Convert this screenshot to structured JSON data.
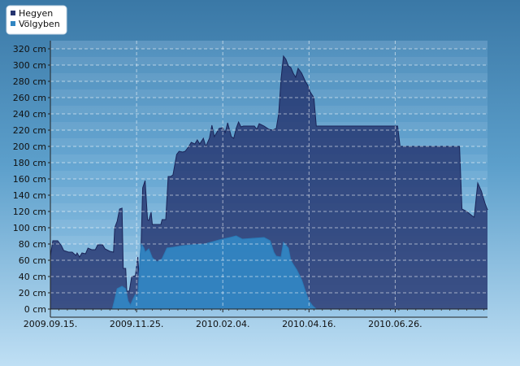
{
  "chart_data": {
    "type": "area",
    "y_unit": "cm",
    "ylim": [
      0,
      330
    ],
    "y_ticks": [
      "0 cm",
      "20 cm",
      "40 cm",
      "60 cm",
      "80 cm",
      "100 cm",
      "120 cm",
      "140 cm",
      "160 cm",
      "180 cm",
      "200 cm",
      "220 cm",
      "240 cm",
      "260 cm",
      "280 cm",
      "300 cm",
      "320 cm"
    ],
    "y_tick_values": [
      0,
      20,
      40,
      60,
      80,
      100,
      120,
      140,
      160,
      180,
      200,
      220,
      240,
      260,
      280,
      300,
      320
    ],
    "x_range": [
      "2009-09-15",
      "2010-09-10"
    ],
    "x_ticks": [
      {
        "date": "2009-09-15",
        "label": "2009.09.15."
      },
      {
        "date": "2009-11-25",
        "label": "2009.11.25."
      },
      {
        "date": "2010-02-04",
        "label": "2010.02.04."
      },
      {
        "date": "2010-04-16",
        "label": "2010.04.16."
      },
      {
        "date": "2010-06-26",
        "label": "2010.06.26."
      }
    ],
    "grid": true,
    "legend_position": "top-left",
    "series": [
      {
        "name": "Hegyen",
        "color": "#25346f",
        "points": [
          [
            "2009-09-15",
            65
          ],
          [
            "2009-09-17",
            84
          ],
          [
            "2009-09-21",
            84
          ],
          [
            "2009-09-24",
            78
          ],
          [
            "2009-09-26",
            72
          ],
          [
            "2009-09-30",
            70
          ],
          [
            "2009-10-03",
            70
          ],
          [
            "2009-10-06",
            66
          ],
          [
            "2009-10-07",
            69
          ],
          [
            "2009-10-09",
            64
          ],
          [
            "2009-10-11",
            69
          ],
          [
            "2009-10-14",
            68
          ],
          [
            "2009-10-16",
            75
          ],
          [
            "2009-10-19",
            73
          ],
          [
            "2009-10-22",
            73
          ],
          [
            "2009-10-24",
            79
          ],
          [
            "2009-10-28",
            79
          ],
          [
            "2009-10-30",
            74
          ],
          [
            "2009-11-03",
            71
          ],
          [
            "2009-11-06",
            70
          ],
          [
            "2009-11-07",
            100
          ],
          [
            "2009-11-09",
            108
          ],
          [
            "2009-11-11",
            123
          ],
          [
            "2009-11-13",
            124
          ],
          [
            "2009-11-14",
            50
          ],
          [
            "2009-11-16",
            50
          ],
          [
            "2009-11-17",
            22
          ],
          [
            "2009-11-19",
            22
          ],
          [
            "2009-11-21",
            40
          ],
          [
            "2009-11-24",
            41
          ],
          [
            "2009-11-26",
            64
          ],
          [
            "2009-11-27",
            43
          ],
          [
            "2009-11-28",
            41
          ],
          [
            "2009-11-30",
            149
          ],
          [
            "2009-12-02",
            158
          ],
          [
            "2009-12-04",
            110
          ],
          [
            "2009-12-05",
            109
          ],
          [
            "2009-12-07",
            119
          ],
          [
            "2009-12-08",
            104
          ],
          [
            "2009-12-12",
            104
          ],
          [
            "2009-12-15",
            104
          ],
          [
            "2009-12-16",
            110
          ],
          [
            "2009-12-19",
            110
          ],
          [
            "2009-12-21",
            163
          ],
          [
            "2009-12-23",
            163
          ],
          [
            "2009-12-25",
            165
          ],
          [
            "2009-12-28",
            190
          ],
          [
            "2009-12-30",
            194
          ],
          [
            "2010-01-02",
            193
          ],
          [
            "2010-01-04",
            194
          ],
          [
            "2010-01-07",
            200
          ],
          [
            "2010-01-09",
            205
          ],
          [
            "2010-01-12",
            203
          ],
          [
            "2010-01-14",
            208
          ],
          [
            "2010-01-16",
            203
          ],
          [
            "2010-01-19",
            210
          ],
          [
            "2010-01-21",
            200
          ],
          [
            "2010-01-24",
            210
          ],
          [
            "2010-01-26",
            226
          ],
          [
            "2010-01-28",
            212
          ],
          [
            "2010-02-01",
            222
          ],
          [
            "2010-02-04",
            223
          ],
          [
            "2010-02-06",
            217
          ],
          [
            "2010-02-08",
            229
          ],
          [
            "2010-02-11",
            212
          ],
          [
            "2010-02-13",
            210
          ],
          [
            "2010-02-15",
            222
          ],
          [
            "2010-02-17",
            230
          ],
          [
            "2010-02-19",
            224
          ],
          [
            "2010-02-21",
            225
          ],
          [
            "2010-02-25",
            225
          ],
          [
            "2010-03-02",
            225
          ],
          [
            "2010-03-04",
            221
          ],
          [
            "2010-03-06",
            228
          ],
          [
            "2010-03-10",
            225
          ],
          [
            "2010-03-14",
            221
          ],
          [
            "2010-03-17",
            220
          ],
          [
            "2010-03-20",
            222
          ],
          [
            "2010-03-22",
            240
          ],
          [
            "2010-03-24",
            283
          ],
          [
            "2010-03-26",
            311
          ],
          [
            "2010-03-28",
            307
          ],
          [
            "2010-03-30",
            299
          ],
          [
            "2010-04-01",
            297
          ],
          [
            "2010-04-03",
            290
          ],
          [
            "2010-04-05",
            285
          ],
          [
            "2010-04-07",
            296
          ],
          [
            "2010-04-10",
            290
          ],
          [
            "2010-04-13",
            280
          ],
          [
            "2010-04-15",
            275
          ],
          [
            "2010-04-17",
            267
          ],
          [
            "2010-04-20",
            260
          ],
          [
            "2010-04-22",
            225
          ],
          [
            "2010-05-01",
            225
          ],
          [
            "2010-05-15",
            225
          ],
          [
            "2010-06-01",
            225
          ],
          [
            "2010-06-15",
            225
          ],
          [
            "2010-06-28",
            225
          ],
          [
            "2010-06-30",
            200
          ],
          [
            "2010-07-15",
            200
          ],
          [
            "2010-08-01",
            200
          ],
          [
            "2010-08-18",
            200
          ],
          [
            "2010-08-20",
            123
          ],
          [
            "2010-08-24",
            120
          ],
          [
            "2010-08-28",
            115
          ],
          [
            "2010-08-30",
            113
          ],
          [
            "2010-09-02",
            155
          ],
          [
            "2010-09-05",
            145
          ],
          [
            "2010-09-08",
            130
          ],
          [
            "2010-09-10",
            122
          ],
          [
            "2010-09-12",
            123
          ]
        ]
      },
      {
        "name": "Völgyben",
        "color": "#3185c2",
        "points": [
          [
            "2009-11-05",
            0
          ],
          [
            "2009-11-07",
            12
          ],
          [
            "2009-11-09",
            25
          ],
          [
            "2009-11-13",
            28
          ],
          [
            "2009-11-16",
            25
          ],
          [
            "2009-11-18",
            10
          ],
          [
            "2009-11-20",
            5
          ],
          [
            "2009-11-22",
            12
          ],
          [
            "2009-11-24",
            18
          ],
          [
            "2009-11-26",
            15
          ],
          [
            "2009-11-28",
            68
          ],
          [
            "2009-11-29",
            80
          ],
          [
            "2009-12-01",
            75
          ],
          [
            "2009-12-02",
            70
          ],
          [
            "2009-12-05",
            74
          ],
          [
            "2009-12-08",
            63
          ],
          [
            "2009-12-12",
            58
          ],
          [
            "2009-12-16",
            62
          ],
          [
            "2009-12-20",
            75
          ],
          [
            "2009-12-25",
            76
          ],
          [
            "2010-01-02",
            78
          ],
          [
            "2010-01-10",
            79
          ],
          [
            "2010-01-20",
            80
          ],
          [
            "2010-02-01",
            85
          ],
          [
            "2010-02-10",
            88
          ],
          [
            "2010-02-15",
            90
          ],
          [
            "2010-02-20",
            86
          ],
          [
            "2010-03-01",
            87
          ],
          [
            "2010-03-10",
            88
          ],
          [
            "2010-03-15",
            84
          ],
          [
            "2010-03-18",
            70
          ],
          [
            "2010-03-20",
            65
          ],
          [
            "2010-03-24",
            64
          ],
          [
            "2010-03-26",
            82
          ],
          [
            "2010-03-30",
            75
          ],
          [
            "2010-04-01",
            60
          ],
          [
            "2010-04-03",
            55
          ],
          [
            "2010-04-06",
            48
          ],
          [
            "2010-04-10",
            36
          ],
          [
            "2010-04-14",
            18
          ],
          [
            "2010-04-16",
            10
          ],
          [
            "2010-04-19",
            4
          ],
          [
            "2010-04-22",
            0
          ]
        ]
      }
    ]
  }
}
